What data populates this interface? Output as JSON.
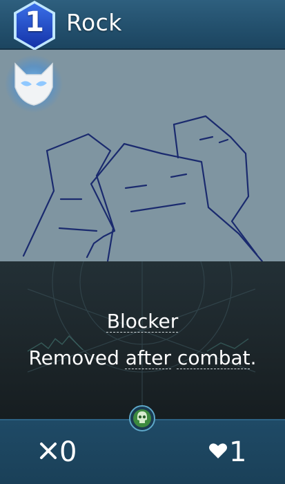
{
  "card": {
    "cost": "1",
    "title": "Rock",
    "keyword": "Blocker",
    "ability": {
      "part1": "Removed ",
      "link1": "after",
      "part2": " ",
      "link2": "combat",
      "part3": "."
    },
    "attack": "0",
    "health": "1"
  },
  "icons": {
    "faction": "mask-icon",
    "type": "skull-icon",
    "attack": "crossed-swords-icon",
    "health": "heart-icon"
  },
  "colors": {
    "header": "#23506d",
    "art_background": "#7f95a1",
    "art_lines": "#1a2a6e",
    "cost_gem": "#1a45c8",
    "text": "#ffffff",
    "type_icon": "#3d8a3f"
  }
}
